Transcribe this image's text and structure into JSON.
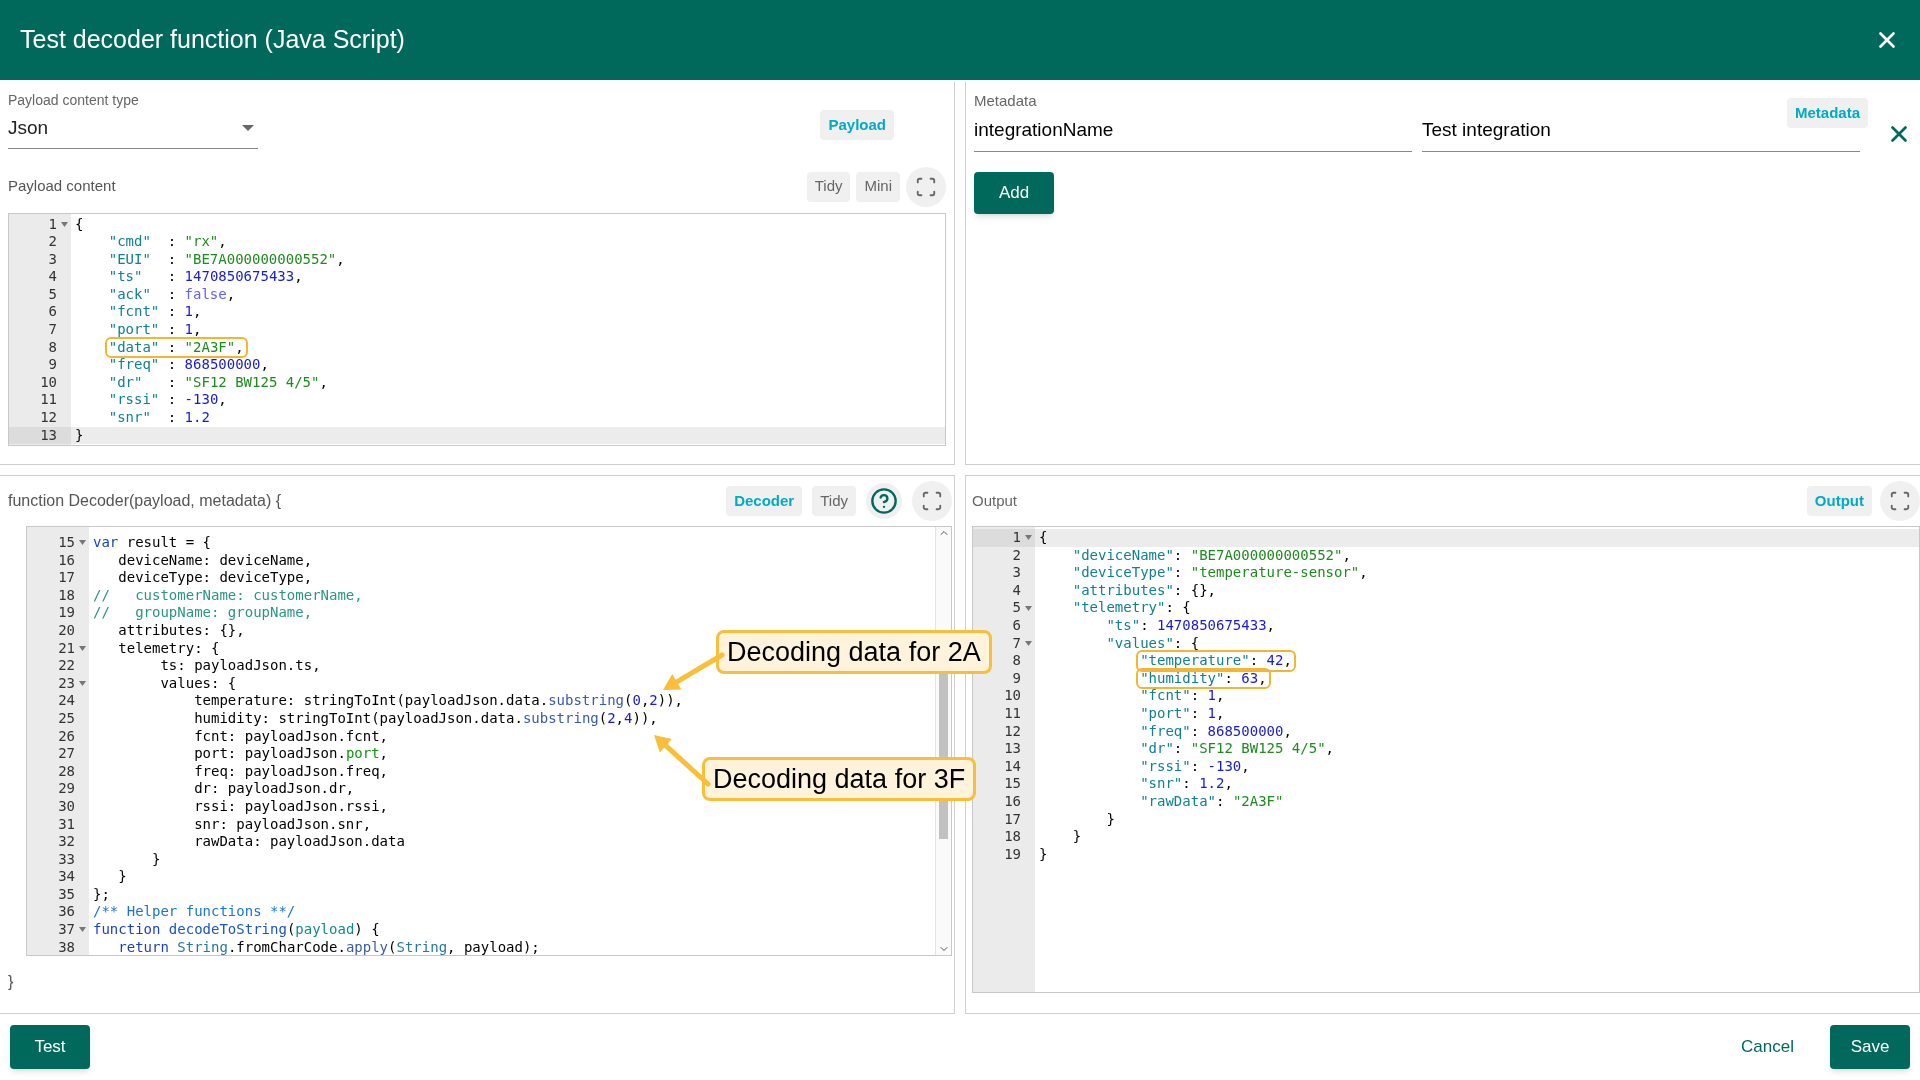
{
  "dialog": {
    "title": "Test decoder function (Java Script)"
  },
  "payload": {
    "type_label": "Payload content type",
    "type_value": "Json",
    "chip": "Payload",
    "content_label": "Payload content",
    "buttons": [
      "Tidy",
      "Mini"
    ],
    "editor": {
      "lines": [
        {
          "n": "1",
          "fold": true,
          "active": false,
          "tokens": [
            {
              "kind": "plain",
              "text": "{"
            }
          ]
        },
        {
          "n": "2",
          "fold": false,
          "active": false,
          "tokens": [
            {
              "kind": "key",
              "text": "    \"cmd\""
            },
            {
              "kind": "plain",
              "text": "  : "
            },
            {
              "kind": "string",
              "text": "\"rx\""
            },
            {
              "kind": "plain",
              "text": ","
            }
          ]
        },
        {
          "n": "3",
          "fold": false,
          "active": false,
          "tokens": [
            {
              "kind": "key",
              "text": "    \"EUI\""
            },
            {
              "kind": "plain",
              "text": "  : "
            },
            {
              "kind": "string",
              "text": "\"BE7A000000000552\""
            },
            {
              "kind": "plain",
              "text": ","
            }
          ]
        },
        {
          "n": "4",
          "fold": false,
          "active": false,
          "tokens": [
            {
              "kind": "key",
              "text": "    \"ts\""
            },
            {
              "kind": "plain",
              "text": "   : "
            },
            {
              "kind": "number",
              "text": "1470850675433"
            },
            {
              "kind": "plain",
              "text": ","
            }
          ]
        },
        {
          "n": "5",
          "fold": false,
          "active": false,
          "tokens": [
            {
              "kind": "key",
              "text": "    \"ack\""
            },
            {
              "kind": "plain",
              "text": "  : "
            },
            {
              "kind": "boolean",
              "text": "false"
            },
            {
              "kind": "plain",
              "text": ","
            }
          ]
        },
        {
          "n": "6",
          "fold": false,
          "active": false,
          "tokens": [
            {
              "kind": "key",
              "text": "    \"fcnt\""
            },
            {
              "kind": "plain",
              "text": " : "
            },
            {
              "kind": "number",
              "text": "1"
            },
            {
              "kind": "plain",
              "text": ","
            }
          ]
        },
        {
          "n": "7",
          "fold": false,
          "active": false,
          "tokens": [
            {
              "kind": "key",
              "text": "    \"port\""
            },
            {
              "kind": "plain",
              "text": " : "
            },
            {
              "kind": "number",
              "text": "1"
            },
            {
              "kind": "plain",
              "text": ","
            }
          ]
        },
        {
          "n": "8",
          "fold": false,
          "active": false,
          "tokens": [
            {
              "kind": "key",
              "text": "    \"data\"",
              "mark": true
            },
            {
              "kind": "plain",
              "text": " : ",
              "mark": true
            },
            {
              "kind": "string",
              "text": "\"2A3F\"",
              "mark": true
            },
            {
              "kind": "plain",
              "text": ",",
              "mark": true
            }
          ]
        },
        {
          "n": "9",
          "fold": false,
          "active": false,
          "tokens": [
            {
              "kind": "key",
              "text": "    \"freq\""
            },
            {
              "kind": "plain",
              "text": " : "
            },
            {
              "kind": "number",
              "text": "868500000"
            },
            {
              "kind": "plain",
              "text": ","
            }
          ]
        },
        {
          "n": "10",
          "fold": false,
          "active": false,
          "tokens": [
            {
              "kind": "key",
              "text": "    \"dr\""
            },
            {
              "kind": "plain",
              "text": "   : "
            },
            {
              "kind": "string",
              "text": "\"SF12 BW125 4/5\""
            },
            {
              "kind": "plain",
              "text": ","
            }
          ]
        },
        {
          "n": "11",
          "fold": false,
          "active": false,
          "tokens": [
            {
              "kind": "key",
              "text": "    \"rssi\""
            },
            {
              "kind": "plain",
              "text": " : "
            },
            {
              "kind": "number",
              "text": "-130"
            },
            {
              "kind": "plain",
              "text": ","
            }
          ]
        },
        {
          "n": "12",
          "fold": false,
          "active": false,
          "tokens": [
            {
              "kind": "key",
              "text": "    \"snr\""
            },
            {
              "kind": "plain",
              "text": "  : "
            },
            {
              "kind": "number",
              "text": "1.2"
            }
          ]
        },
        {
          "n": "13",
          "fold": false,
          "active": true,
          "tokens": [
            {
              "kind": "plain",
              "text": "}"
            }
          ]
        }
      ]
    }
  },
  "metadata": {
    "label": "Metadata",
    "chip": "Metadata",
    "entries": [
      {
        "key": "integrationName",
        "value": "Test integration"
      }
    ],
    "add_button": "Add"
  },
  "decoder": {
    "signature": "function Decoder(payload, metadata) {",
    "chip": "Decoder",
    "buttons": [
      "Tidy"
    ],
    "closing": "}",
    "editor": {
      "lines": [
        {
          "n": "15",
          "fold": true,
          "active": false,
          "tokens": [
            {
              "kind": "keyword",
              "text": "var"
            },
            {
              "kind": "plain",
              "text": " result = {"
            }
          ]
        },
        {
          "n": "16",
          "fold": false,
          "active": false,
          "tokens": [
            {
              "kind": "plain",
              "text": "   deviceName: deviceName,"
            }
          ]
        },
        {
          "n": "17",
          "fold": false,
          "active": false,
          "tokens": [
            {
              "kind": "plain",
              "text": "   deviceType: deviceType,"
            }
          ]
        },
        {
          "n": "18",
          "fold": false,
          "active": false,
          "tokens": [
            {
              "kind": "comment",
              "text": "//   customerName: customerName,"
            }
          ]
        },
        {
          "n": "19",
          "fold": false,
          "active": false,
          "tokens": [
            {
              "kind": "comment",
              "text": "//   groupName: groupName,"
            }
          ]
        },
        {
          "n": "20",
          "fold": false,
          "active": false,
          "tokens": [
            {
              "kind": "plain",
              "text": "   attributes: {},"
            }
          ]
        },
        {
          "n": "21",
          "fold": true,
          "active": false,
          "tokens": [
            {
              "kind": "plain",
              "text": "   telemetry: {"
            }
          ]
        },
        {
          "n": "22",
          "fold": false,
          "active": false,
          "tokens": [
            {
              "kind": "plain",
              "text": "        ts: payloadJson.ts,"
            }
          ]
        },
        {
          "n": "23",
          "fold": true,
          "active": false,
          "tokens": [
            {
              "kind": "plain",
              "text": "        values: {"
            }
          ]
        },
        {
          "n": "24",
          "fold": false,
          "active": false,
          "tokens": [
            {
              "kind": "plain",
              "text": "            temperature: stringToInt(payloadJson.data."
            },
            {
              "kind": "method",
              "text": "substring"
            },
            {
              "kind": "plain",
              "text": "("
            },
            {
              "kind": "number",
              "text": "0"
            },
            {
              "kind": "plain",
              "text": ","
            },
            {
              "kind": "number",
              "text": "2"
            },
            {
              "kind": "plain",
              "text": ")),"
            }
          ]
        },
        {
          "n": "25",
          "fold": false,
          "active": false,
          "tokens": [
            {
              "kind": "plain",
              "text": "            humidity: stringToInt(payloadJson.data."
            },
            {
              "kind": "method",
              "text": "substring"
            },
            {
              "kind": "plain",
              "text": "("
            },
            {
              "kind": "number",
              "text": "2"
            },
            {
              "kind": "plain",
              "text": ","
            },
            {
              "kind": "number",
              "text": "4"
            },
            {
              "kind": "plain",
              "text": ")),"
            }
          ]
        },
        {
          "n": "26",
          "fold": false,
          "active": false,
          "tokens": [
            {
              "kind": "plain",
              "text": "            fcnt: payloadJson.fcnt,"
            }
          ]
        },
        {
          "n": "27",
          "fold": false,
          "active": false,
          "tokens": [
            {
              "kind": "plain",
              "text": "            port: payloadJson."
            },
            {
              "kind": "property",
              "text": "port"
            },
            {
              "kind": "plain",
              "text": ","
            }
          ]
        },
        {
          "n": "28",
          "fold": false,
          "active": false,
          "tokens": [
            {
              "kind": "plain",
              "text": "            freq: payloadJson.freq,"
            }
          ]
        },
        {
          "n": "29",
          "fold": false,
          "active": false,
          "tokens": [
            {
              "kind": "plain",
              "text": "            dr: payloadJson.dr,"
            }
          ]
        },
        {
          "n": "30",
          "fold": false,
          "active": false,
          "tokens": [
            {
              "kind": "plain",
              "text": "            rssi: payloadJson.rssi,"
            }
          ]
        },
        {
          "n": "31",
          "fold": false,
          "active": false,
          "tokens": [
            {
              "kind": "plain",
              "text": "            snr: payloadJson.snr,"
            }
          ]
        },
        {
          "n": "32",
          "fold": false,
          "active": false,
          "tokens": [
            {
              "kind": "plain",
              "text": "            rawData: payloadJson.data"
            }
          ]
        },
        {
          "n": "33",
          "fold": false,
          "active": false,
          "tokens": [
            {
              "kind": "plain",
              "text": "       }"
            }
          ]
        },
        {
          "n": "34",
          "fold": false,
          "active": false,
          "tokens": [
            {
              "kind": "plain",
              "text": "   }"
            }
          ]
        },
        {
          "n": "35",
          "fold": false,
          "active": false,
          "tokens": [
            {
              "kind": "plain",
              "text": "};"
            }
          ]
        },
        {
          "n": "36",
          "fold": false,
          "active": false,
          "tokens": [
            {
              "kind": "doc",
              "text": "/** Helper functions **/"
            }
          ]
        },
        {
          "n": "37",
          "fold": true,
          "active": false,
          "tokens": [
            {
              "kind": "keyword",
              "text": "function"
            },
            {
              "kind": "function",
              "text": " decodeToString"
            },
            {
              "kind": "plain",
              "text": "("
            },
            {
              "kind": "param",
              "text": "payload"
            },
            {
              "kind": "plain",
              "text": ") {"
            }
          ]
        },
        {
          "n": "38",
          "fold": false,
          "active": false,
          "tokens": [
            {
              "kind": "keyword",
              "text": "   return"
            },
            {
              "kind": "class",
              "text": " String"
            },
            {
              "kind": "plain",
              "text": ".fromCharCode."
            },
            {
              "kind": "method",
              "text": "apply"
            },
            {
              "kind": "plain",
              "text": "("
            },
            {
              "kind": "class",
              "text": "String"
            },
            {
              "kind": "plain",
              "text": ", payload);"
            }
          ]
        }
      ]
    }
  },
  "callouts": [
    {
      "text": "Decoding data for 2A"
    },
    {
      "text": "Decoding data for 3F"
    }
  ],
  "output": {
    "label": "Output",
    "chip": "Output",
    "editor": {
      "lines": [
        {
          "n": "1",
          "fold": true,
          "active": true,
          "tokens": [
            {
              "kind": "plain",
              "text": "{"
            }
          ]
        },
        {
          "n": "2",
          "fold": false,
          "active": false,
          "tokens": [
            {
              "kind": "key",
              "text": "    \"deviceName\""
            },
            {
              "kind": "plain",
              "text": ": "
            },
            {
              "kind": "string",
              "text": "\"BE7A000000000552\""
            },
            {
              "kind": "plain",
              "text": ","
            }
          ]
        },
        {
          "n": "3",
          "fold": false,
          "active": false,
          "tokens": [
            {
              "kind": "key",
              "text": "    \"deviceType\""
            },
            {
              "kind": "plain",
              "text": ": "
            },
            {
              "kind": "string",
              "text": "\"temperature-sensor\""
            },
            {
              "kind": "plain",
              "text": ","
            }
          ]
        },
        {
          "n": "4",
          "fold": false,
          "active": false,
          "tokens": [
            {
              "kind": "key",
              "text": "    \"attributes\""
            },
            {
              "kind": "plain",
              "text": ": {},"
            }
          ]
        },
        {
          "n": "5",
          "fold": true,
          "active": false,
          "tokens": [
            {
              "kind": "key",
              "text": "    \"telemetry\""
            },
            {
              "kind": "plain",
              "text": ": {"
            }
          ]
        },
        {
          "n": "6",
          "fold": false,
          "active": false,
          "tokens": [
            {
              "kind": "key",
              "text": "        \"ts\""
            },
            {
              "kind": "plain",
              "text": ": "
            },
            {
              "kind": "number",
              "text": "1470850675433"
            },
            {
              "kind": "plain",
              "text": ","
            }
          ]
        },
        {
          "n": "7",
          "fold": true,
          "active": false,
          "tokens": [
            {
              "kind": "key",
              "text": "        \"values\""
            },
            {
              "kind": "plain",
              "text": ": {"
            }
          ]
        },
        {
          "n": "8",
          "fold": false,
          "active": false,
          "tokens": [
            {
              "kind": "key",
              "text": "            \"temperature\"",
              "mark": true
            },
            {
              "kind": "plain",
              "text": ": ",
              "mark": true
            },
            {
              "kind": "number",
              "text": "42",
              "mark": true
            },
            {
              "kind": "plain",
              "text": ",",
              "mark": true
            }
          ]
        },
        {
          "n": "9",
          "fold": false,
          "active": false,
          "tokens": [
            {
              "kind": "key",
              "text": "            \"humidity\"",
              "mark": true
            },
            {
              "kind": "plain",
              "text": ": ",
              "mark": true
            },
            {
              "kind": "number",
              "text": "63",
              "mark": true
            },
            {
              "kind": "plain",
              "text": ",",
              "mark": true
            }
          ]
        },
        {
          "n": "10",
          "fold": false,
          "active": false,
          "tokens": [
            {
              "kind": "key",
              "text": "            \"fcnt\""
            },
            {
              "kind": "plain",
              "text": ": "
            },
            {
              "kind": "number",
              "text": "1"
            },
            {
              "kind": "plain",
              "text": ","
            }
          ]
        },
        {
          "n": "11",
          "fold": false,
          "active": false,
          "tokens": [
            {
              "kind": "key",
              "text": "            \"port\""
            },
            {
              "kind": "plain",
              "text": ": "
            },
            {
              "kind": "number",
              "text": "1"
            },
            {
              "kind": "plain",
              "text": ","
            }
          ]
        },
        {
          "n": "12",
          "fold": false,
          "active": false,
          "tokens": [
            {
              "kind": "key",
              "text": "            \"freq\""
            },
            {
              "kind": "plain",
              "text": ": "
            },
            {
              "kind": "number",
              "text": "868500000"
            },
            {
              "kind": "plain",
              "text": ","
            }
          ]
        },
        {
          "n": "13",
          "fold": false,
          "active": false,
          "tokens": [
            {
              "kind": "key",
              "text": "            \"dr\""
            },
            {
              "kind": "plain",
              "text": ": "
            },
            {
              "kind": "string",
              "text": "\"SF12 BW125 4/5\""
            },
            {
              "kind": "plain",
              "text": ","
            }
          ]
        },
        {
          "n": "14",
          "fold": false,
          "active": false,
          "tokens": [
            {
              "kind": "key",
              "text": "            \"rssi\""
            },
            {
              "kind": "plain",
              "text": ": "
            },
            {
              "kind": "number",
              "text": "-130"
            },
            {
              "kind": "plain",
              "text": ","
            }
          ]
        },
        {
          "n": "15",
          "fold": false,
          "active": false,
          "tokens": [
            {
              "kind": "key",
              "text": "            \"snr\""
            },
            {
              "kind": "plain",
              "text": ": "
            },
            {
              "kind": "number",
              "text": "1.2"
            },
            {
              "kind": "plain",
              "text": ","
            }
          ]
        },
        {
          "n": "16",
          "fold": false,
          "active": false,
          "tokens": [
            {
              "kind": "key",
              "text": "            \"rawData\""
            },
            {
              "kind": "plain",
              "text": ": "
            },
            {
              "kind": "string",
              "text": "\"2A3F\""
            }
          ]
        },
        {
          "n": "17",
          "fold": false,
          "active": false,
          "tokens": [
            {
              "kind": "plain",
              "text": "        }"
            }
          ]
        },
        {
          "n": "18",
          "fold": false,
          "active": false,
          "tokens": [
            {
              "kind": "plain",
              "text": "    }"
            }
          ]
        },
        {
          "n": "19",
          "fold": false,
          "active": false,
          "tokens": [
            {
              "kind": "plain",
              "text": "}"
            }
          ]
        }
      ]
    }
  },
  "footer": {
    "test": "Test",
    "cancel": "Cancel",
    "save": "Save"
  }
}
